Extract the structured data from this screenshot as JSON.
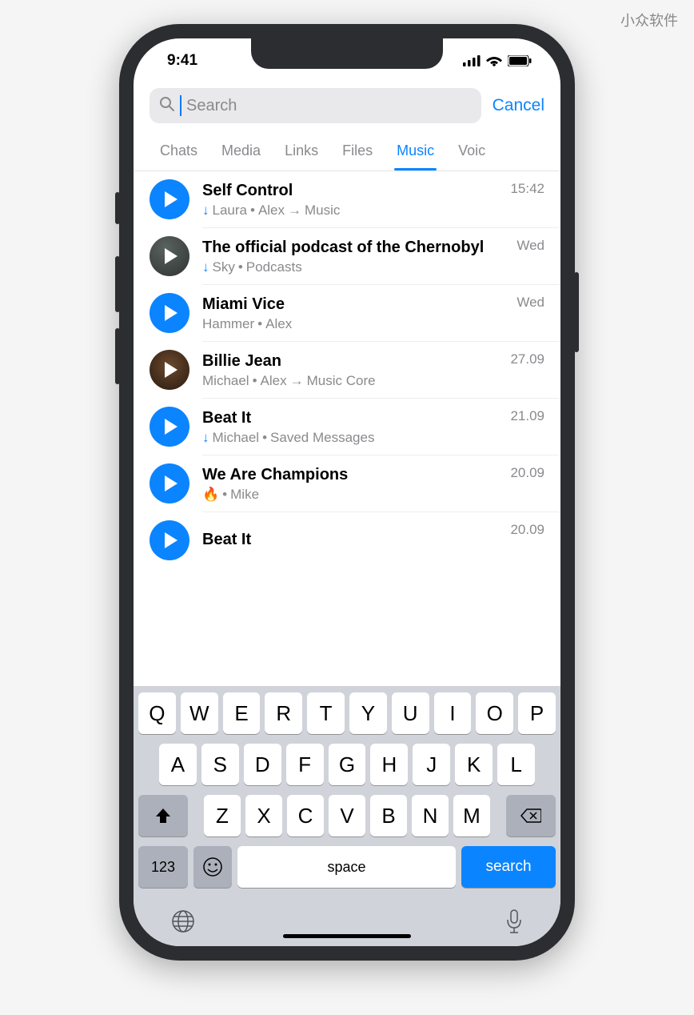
{
  "watermark": "小众软件",
  "status": {
    "time": "9:41"
  },
  "search": {
    "placeholder": "Search",
    "cancel": "Cancel"
  },
  "tabs": [
    "Chats",
    "Media",
    "Links",
    "Files",
    "Music",
    "Voic"
  ],
  "active_tab": "Music",
  "items": [
    {
      "title": "Self Control",
      "time": "15:42",
      "download": true,
      "sub_parts": [
        "Laura",
        " • ",
        "Alex ",
        "→",
        "Music"
      ],
      "icon": "play"
    },
    {
      "title": "The official podcast of the Chernobyl",
      "time": "Wed",
      "download": true,
      "sub_parts": [
        "Sky",
        " • ",
        "Podcasts"
      ],
      "icon": "img1"
    },
    {
      "title": "Miami Vice",
      "time": "Wed",
      "download": false,
      "sub_parts": [
        "Hammer",
        " • ",
        "Alex"
      ],
      "icon": "play"
    },
    {
      "title": "Billie Jean",
      "time": "27.09",
      "download": false,
      "sub_parts": [
        "Michael",
        " • ",
        "Alex ",
        "→",
        "Music Core"
      ],
      "icon": "img2"
    },
    {
      "title": "Beat It",
      "time": "21.09",
      "download": true,
      "sub_parts": [
        "Michael",
        " • ",
        "Saved Messages"
      ],
      "icon": "play"
    },
    {
      "title": "We Are Champions",
      "time": "20.09",
      "download": false,
      "fire": true,
      "sub_parts": [
        " • ",
        "Mike"
      ],
      "icon": "play"
    },
    {
      "title": "Beat It",
      "time": "20.09",
      "download": false,
      "sub_parts": [],
      "icon": "play"
    }
  ],
  "keyboard": {
    "row1": [
      "Q",
      "W",
      "E",
      "R",
      "T",
      "Y",
      "U",
      "I",
      "O",
      "P"
    ],
    "row2": [
      "A",
      "S",
      "D",
      "F",
      "G",
      "H",
      "J",
      "K",
      "L"
    ],
    "row3": [
      "Z",
      "X",
      "C",
      "V",
      "B",
      "N",
      "M"
    ],
    "num": "123",
    "space": "space",
    "search": "search"
  }
}
